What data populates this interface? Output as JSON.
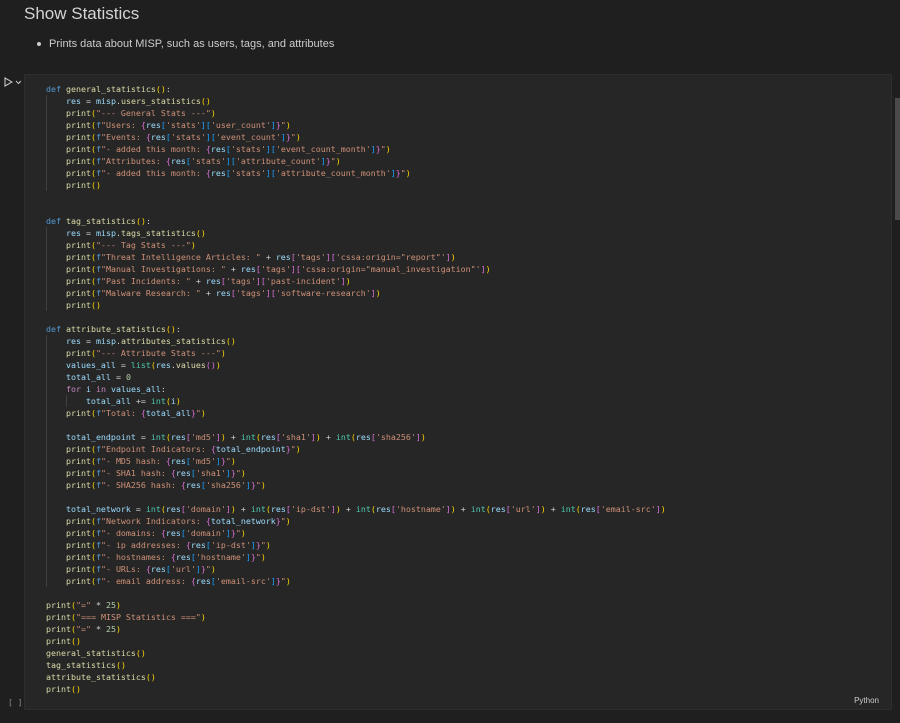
{
  "markdown": {
    "title": "Show Statistics",
    "bullets": [
      "Prints data about MISP, such as users, tags, and attributes"
    ]
  },
  "cell": {
    "execution_count": "[ ]",
    "language": "Python",
    "run_icon": "play-icon",
    "code_lines": [
      "def general_statistics():",
      "    res = misp.users_statistics()",
      "    print(\"--- General Stats ---\")",
      "    print(f\"Users: {res['stats']['user_count']}\")",
      "    print(f\"Events: {res['stats']['event_count']}\")",
      "    print(f\"- added this month: {res['stats']['event_count_month']}\")",
      "    print(f\"Attributes: {res['stats']['attribute_count']}\")",
      "    print(f\"- added this month: {res['stats']['attribute_count_month']}\")",
      "    print()",
      "",
      "",
      "def tag_statistics():",
      "    res = misp.tags_statistics()",
      "    print(\"--- Tag Stats ---\")",
      "    print(f\"Threat Intelligence Articles: \" + res['tags']['cssa:origin=\"report\"'])",
      "    print(f\"Manual Investigations: \" + res['tags']['cssa:origin=\"manual_investigation\"'])",
      "    print(f\"Past Incidents: \" + res['tags']['past-incident'])",
      "    print(f\"Malware Research: \" + res['tags']['software-research'])",
      "    print()",
      "",
      "def attribute_statistics():",
      "    res = misp.attributes_statistics()",
      "    print(\"--- Attribute Stats ---\")",
      "    values_all = list(res.values())",
      "    total_all = 0",
      "    for i in values_all:",
      "        total_all += int(i)",
      "    print(f\"Total: {total_all}\")",
      "",
      "    total_endpoint = int(res['md5']) + int(res['sha1']) + int(res['sha256'])",
      "    print(f\"Endpoint Indicators: {total_endpoint}\")",
      "    print(f\"- MD5 hash: {res['md5']}\")",
      "    print(f\"- SHA1 hash: {res['sha1']}\")",
      "    print(f\"- SHA256 hash: {res['sha256']}\")",
      "",
      "    total_network = int(res['domain']) + int(res['ip-dst']) + int(res['hostname']) + int(res['url']) + int(res['email-src'])",
      "    print(f\"Network Indicators: {total_network}\")",
      "    print(f\"- domains: {res['domain']}\")",
      "    print(f\"- ip addresses: {res['ip-dst']}\")",
      "    print(f\"- hostnames: {res['hostname']}\")",
      "    print(f\"- URLs: {res['url']}\")",
      "    print(f\"- email address: {res['email-src']}\")",
      "",
      "print(\"=\" * 25)",
      "print(\"=== MISP Statistics ===\")",
      "print(\"=\" * 25)",
      "print()",
      "general_statistics()",
      "tag_statistics()",
      "attribute_statistics()",
      "print()"
    ]
  },
  "colors": {
    "background": "#1f1f1f",
    "cell_background": "#262626",
    "keyword": "#569cd6",
    "function": "#dcdcaa",
    "variable": "#9cdcfe",
    "string": "#ce9178"
  }
}
